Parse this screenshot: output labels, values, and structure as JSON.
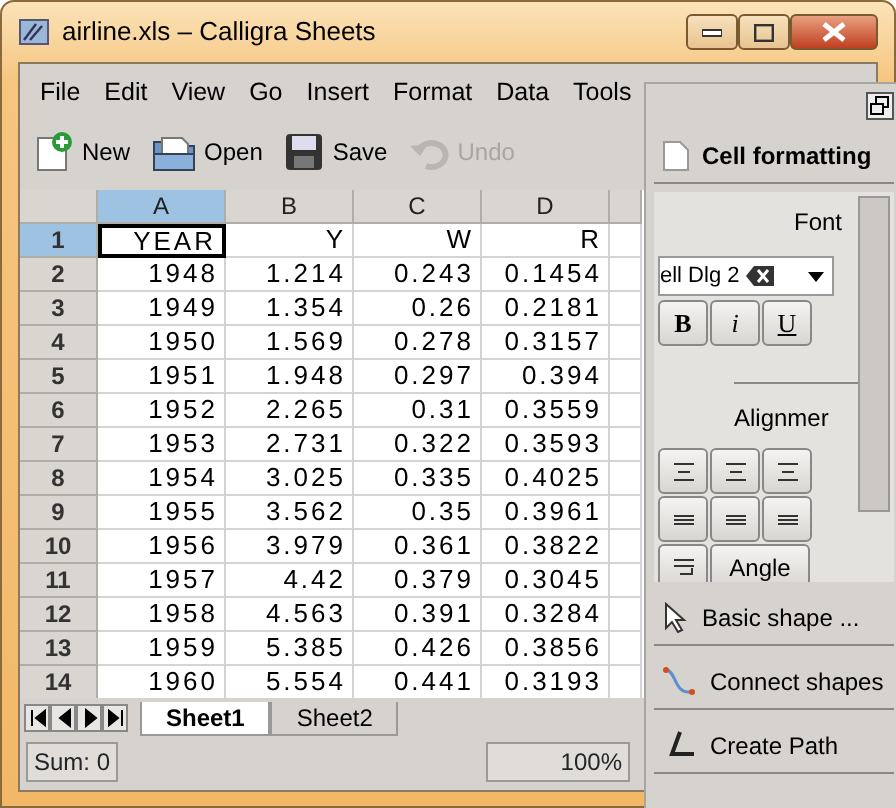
{
  "window": {
    "title": "airline.xls – Calligra Sheets"
  },
  "menu": [
    "File",
    "Edit",
    "View",
    "Go",
    "Insert",
    "Format",
    "Data",
    "Tools"
  ],
  "toolbar": [
    {
      "label": "New",
      "kind": "new",
      "disabled": false
    },
    {
      "label": "Open",
      "kind": "open",
      "disabled": false
    },
    {
      "label": "Save",
      "kind": "save",
      "disabled": false
    },
    {
      "label": "Undo",
      "kind": "undo",
      "disabled": true
    }
  ],
  "sheet": {
    "columns": [
      {
        "label": "A",
        "selected": true
      },
      {
        "label": "B",
        "selected": false
      },
      {
        "label": "C",
        "selected": false
      },
      {
        "label": "D",
        "selected": false
      }
    ],
    "rows": [
      {
        "label": "1",
        "selected": true,
        "cells": [
          "YEAR",
          "Y",
          "W",
          "R"
        ]
      },
      {
        "label": "2",
        "selected": false,
        "cells": [
          "1948",
          "1.214",
          "0.243",
          "0.1454"
        ]
      },
      {
        "label": "3",
        "selected": false,
        "cells": [
          "1949",
          "1.354",
          "0.26",
          "0.2181"
        ]
      },
      {
        "label": "4",
        "selected": false,
        "cells": [
          "1950",
          "1.569",
          "0.278",
          "0.3157"
        ]
      },
      {
        "label": "5",
        "selected": false,
        "cells": [
          "1951",
          "1.948",
          "0.297",
          "0.394"
        ]
      },
      {
        "label": "6",
        "selected": false,
        "cells": [
          "1952",
          "2.265",
          "0.31",
          "0.3559"
        ]
      },
      {
        "label": "7",
        "selected": false,
        "cells": [
          "1953",
          "2.731",
          "0.322",
          "0.3593"
        ]
      },
      {
        "label": "8",
        "selected": false,
        "cells": [
          "1954",
          "3.025",
          "0.335",
          "0.4025"
        ]
      },
      {
        "label": "9",
        "selected": false,
        "cells": [
          "1955",
          "3.562",
          "0.35",
          "0.3961"
        ]
      },
      {
        "label": "10",
        "selected": false,
        "cells": [
          "1956",
          "3.979",
          "0.361",
          "0.3822"
        ]
      },
      {
        "label": "11",
        "selected": false,
        "cells": [
          "1957",
          "4.42",
          "0.379",
          "0.3045"
        ]
      },
      {
        "label": "12",
        "selected": false,
        "cells": [
          "1958",
          "4.563",
          "0.391",
          "0.3284"
        ]
      },
      {
        "label": "13",
        "selected": false,
        "cells": [
          "1959",
          "5.385",
          "0.426",
          "0.3856"
        ]
      },
      {
        "label": "14",
        "selected": false,
        "cells": [
          "1960",
          "5.554",
          "0.441",
          "0.3193"
        ]
      }
    ]
  },
  "sheet_tabs": [
    {
      "label": "Sheet1",
      "selected": true
    },
    {
      "label": "Sheet2",
      "selected": false
    }
  ],
  "status_bar": {
    "sum": "Sum: 0",
    "zoom": "100%"
  },
  "docker": {
    "title": "Cell formatting",
    "font_label": "Font",
    "font_name": "ell Dlg 2",
    "style_buttons": [
      "B",
      "i",
      "U"
    ],
    "alignment_label": "Alignmer",
    "angle_button": "Angle",
    "tools": [
      {
        "label": "Basic shape ...",
        "kind": "pointer"
      },
      {
        "label": "Connect shapes",
        "kind": "connect"
      },
      {
        "label": "Create Path",
        "kind": "path"
      }
    ]
  }
}
